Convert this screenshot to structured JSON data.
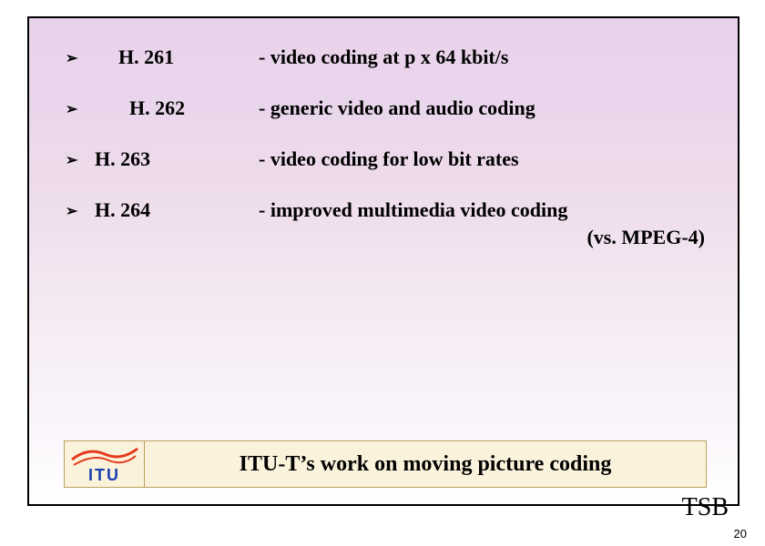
{
  "bullet_glyph": "➢",
  "items": [
    {
      "code": "H. 261",
      "desc": "- video coding at p x 64 kbit/s",
      "indent": "indent1"
    },
    {
      "code": "H. 262",
      "desc": "- generic video and audio coding",
      "indent": "indent2"
    },
    {
      "code": "H. 263",
      "desc": "- video coding for low bit rates",
      "indent": ""
    },
    {
      "code": "H. 264",
      "desc": "- improved multimedia video coding",
      "indent": "",
      "sub": "(vs. MPEG-4)"
    }
  ],
  "logo_text": "ITU",
  "footer_title": "ITU-T’s work on moving picture coding",
  "tsb": "TSB",
  "page_number": "20"
}
